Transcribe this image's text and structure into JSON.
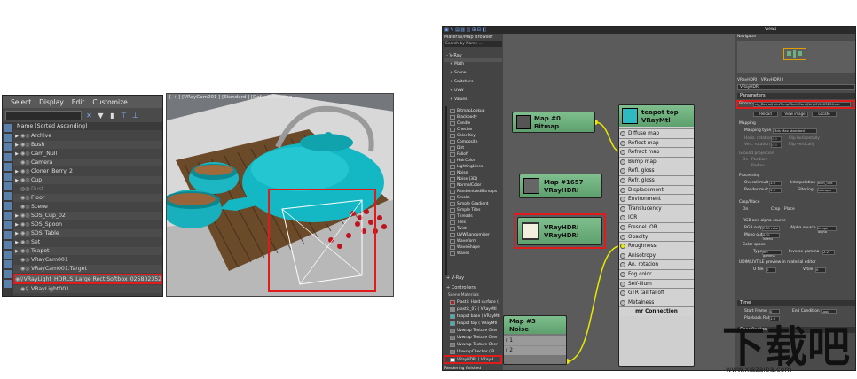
{
  "explorer": {
    "menu": [
      "Select",
      "Display",
      "Edit",
      "Customize"
    ],
    "header": "Name (Sorted Ascending)",
    "items": [
      "Archive",
      "Bush",
      "Cam_Null",
      "Camera",
      "Cloner_Berry_2",
      "Cup",
      "Dust",
      "Floor",
      "Scene",
      "SDS_Cup_02",
      "SDS_Spoon",
      "SDS_Table",
      "Set",
      "Teapot",
      "VRayCam001",
      "VRayCam001.Target",
      "VRayLight_HDRLS_Large Rect Softbox_025802352",
      "VRayLight001"
    ]
  },
  "viewport": {
    "label": "[ + ] [VRayCam001 ] [Standard ] [Default Shading ]"
  },
  "material_editor": {
    "title": "View1",
    "browser_title": "Material/Map Browser",
    "search_placeholder": "Search by Name ...",
    "vray_group": "- V-Ray",
    "categories": [
      "+ Math",
      "+ Scene",
      "+ Switchers",
      "+ UVW",
      "+ Values"
    ],
    "maps": [
      "BitmapLookup",
      "Blackbody",
      "Candle",
      "Checker",
      "Color Key",
      "Composite",
      "Dirt",
      "Falloff",
      "HairColor",
      "LightingLines",
      "Noise",
      "Noise (3D)",
      "NormalColor",
      "RandomizedBitmaps",
      "Smoke",
      "Simple Gradient",
      "Simple Tiles",
      "Threads",
      "Tiles",
      "Twist",
      "UVWRandomizer",
      "Waveform",
      "WaveShape",
      "Waves"
    ],
    "vray_label": "+ V-Ray",
    "controllers_label": "+ Controllers",
    "scene_materials_label": "Scene Materials",
    "scene_materials": [
      "Plastic Hard surface (",
      "plastic_07 ( VRayMtl",
      "teapot base ( VRayMtl",
      "teapot top ( VRayMtl",
      "Uvwrap Texture Cher",
      "Uvwrap Texture Cher",
      "Uvwrap Texture Cher",
      "UnwrapChecker ( B",
      "VRayHDRI ( VRayH"
    ],
    "status": "Rendering finished",
    "nodes": {
      "map0": {
        "title": "Map #0",
        "subtitle": "Bitmap"
      },
      "map1657": {
        "title": "Map #1657",
        "subtitle": "VRayHDRI"
      },
      "vrayhdri": {
        "title": "VRayHDRI",
        "subtitle": "VRayHDRI"
      },
      "map3": {
        "title": "Map #3",
        "subtitle": "Noise",
        "slots": [
          "r 1",
          "r 2"
        ]
      },
      "teapot": {
        "title": "teapot top",
        "subtitle": "VRayMtl",
        "slots": [
          "Diffuse map",
          "Reflect map",
          "Refract map",
          "Bump map",
          "Refl. gloss",
          "Refr. gloss",
          "Displacement",
          "Environment",
          "Translucency",
          "IOR",
          "Fresnel IOR",
          "Opacity",
          "Roughness",
          "Anisotropy",
          "An. rotation",
          "Fog color",
          "Self-illum",
          "GTR tail falloff",
          "Metalness"
        ],
        "footer": "mr Connection"
      }
    },
    "navigator": "Navigator",
    "props": {
      "header": "VRayHDRI ( VRayHDRI )",
      "name": "VRayHDRI",
      "params": "Parameters",
      "bitmap_label": "Bitmap",
      "bitmap_value": "ng_Demo\\HdrsTemp\\Rect\\Card\\Ne\\10\\9603234.exr",
      "reload": "Reload",
      "view_image": "View image",
      "locate": "Locate",
      "mapping": "Mapping",
      "mapping_type_label": "Mapping type",
      "mapping_type": "3ds Max standard",
      "horiz_rot": "Horiz. rotation",
      "vert_rot": "Vert. rotation",
      "flip_h": "Flip horizontally",
      "flip_v": "Flip vertically",
      "ground_proj": "Ground projection",
      "on": "On",
      "position": "Position",
      "radius": "Radius",
      "processing": "Processing",
      "overall_mult": "Overall mult",
      "render_mult": "Render mult",
      "interpolation": "Interpolation",
      "interp_value": "Bilin_unit",
      "filtering": "Filtering",
      "filter_value": "Isotropic",
      "crop_place": "Crop/Place",
      "crop": "Crop",
      "place": "Place",
      "rgb_alpha": "RGB and alpha source",
      "rgb_output": "RGB output",
      "rgb_value": "RGB color",
      "alpha_source": "Alpha source",
      "alpha_value": "Image alpha",
      "mono_output": "Mono output",
      "mono_value": "RGB intens",
      "color_space": "Color space",
      "type": "Type",
      "type_value": "Inv. gamma",
      "inverse_gamma": "Inverse gamma",
      "uvw": "UDIM/UVTILE preview in material editor",
      "u_tile": "U tile",
      "v_tile": "V tile",
      "time": "Time",
      "start_frame": "Start Frame",
      "playback_rate": "Playback Rate",
      "end_condition": "End Condition",
      "end_value": "Loop",
      "coordinates": "Coordinates",
      "val_0": "0.0",
      "val_1": "1.0",
      "val_2": "2.2",
      "val_int0": "0"
    }
  },
  "watermark": {
    "text": "www.xiazaiba.com",
    "logo": "下载吧"
  },
  "colors": {
    "highlight": "#e01b1b",
    "teapot": "#14b8c4",
    "node_header": "#6fb07f"
  }
}
